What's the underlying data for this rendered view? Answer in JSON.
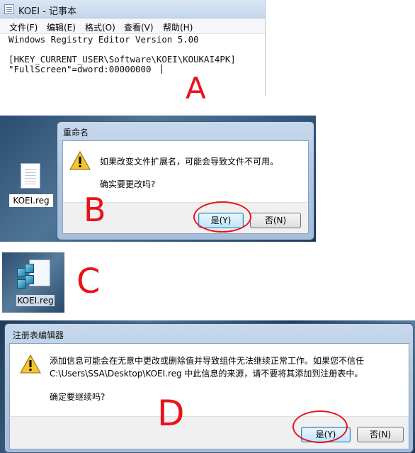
{
  "notepad": {
    "title": "KOEI - 记事本",
    "menu": [
      "文件(F)",
      "编辑(E)",
      "格式(O)",
      "查看(V)",
      "帮助(H)"
    ],
    "lines": [
      "Windows Registry Editor Version 5.00",
      "",
      "[HKEY_CURRENT_USER\\Software\\KOEI\\KOUKAI4PK]",
      "\"FullScreen\"=dword:00000000  "
    ]
  },
  "marks": {
    "a": "A",
    "b": "B",
    "c": "C",
    "d": "D"
  },
  "rename_dialog": {
    "title": "重命名",
    "message1": "如果改变文件扩展名，可能会导致文件不可用。",
    "message2": "确实要更改吗?",
    "yes": "是(Y)",
    "no": "否(N)"
  },
  "desktop_file": {
    "label": "KOEI.reg"
  },
  "reg_file": {
    "label": "KOEI.reg"
  },
  "regedit_dialog": {
    "title": "注册表编辑器",
    "message1": "添加信息可能会在无意中更改或删除值并导致组件无法继续正常工作。如果您不信任",
    "message2": "C:\\Users\\SSA\\Desktop\\KOEI.reg 中此信息的来源，请不要将其添加到注册表中。",
    "message3": "确定要继续吗?",
    "yes": "是(Y)",
    "no": "否(N)"
  },
  "colors": {
    "annotation": "#e8141c",
    "default_button": "#3c7fb1"
  }
}
